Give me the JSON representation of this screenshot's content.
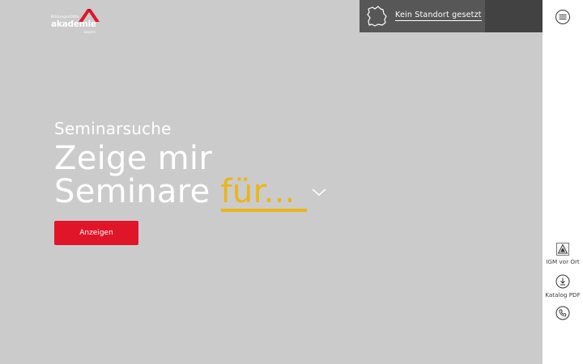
{
  "logo": {
    "tagline": "Bildungsstätte",
    "name": "akademie",
    "region": "bayern",
    "accent": "#e0152a"
  },
  "location": {
    "text": "Kein Standort gesetzt",
    "icon": "bavaria-map-icon"
  },
  "hero": {
    "kicker": "Seminarsuche",
    "line1": "Zeige mir",
    "line2": "Seminare",
    "dropdown_value": "für...",
    "button": "Anzeigen"
  },
  "sidebar": {
    "menu_icon": "menu-icon",
    "items": [
      {
        "label": "IGM vor Ort",
        "icon": "igm-logo-icon"
      },
      {
        "label": "Katalog PDF",
        "icon": "download-icon"
      },
      {
        "label": "",
        "icon": "phone-icon"
      }
    ]
  },
  "colors": {
    "background": "#cbcbcb",
    "accent_red": "#e0152a",
    "accent_yellow": "#e9b51a",
    "location_bar": "#575757"
  }
}
